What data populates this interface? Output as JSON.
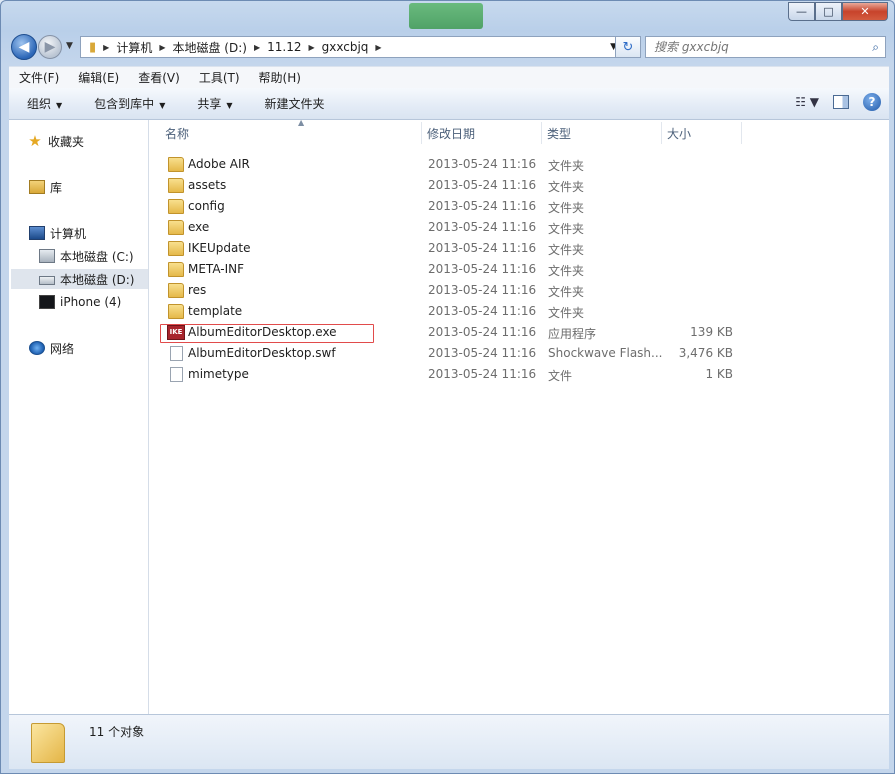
{
  "window": {
    "caption": {
      "minimize": "—",
      "maximize": "□",
      "close": "✕"
    }
  },
  "nav": {
    "back_icon": "back-arrow-icon",
    "forward_icon": "forward-arrow-icon",
    "breadcrumb": [
      "计算机",
      "本地磁盘 (D:)",
      "11.12",
      "gxxcbjq"
    ],
    "search_placeholder": "搜索 gxxcbjq"
  },
  "menubar": [
    "文件(F)",
    "编辑(E)",
    "查看(V)",
    "工具(T)",
    "帮助(H)"
  ],
  "toolbar": {
    "organize": "组织",
    "include_in_library": "包含到库中",
    "share": "共享",
    "new_folder": "新建文件夹"
  },
  "sidebar": {
    "favorites": "收藏夹",
    "libraries": "库",
    "computer": "计算机",
    "drive_c": "本地磁盘 (C:)",
    "drive_d": "本地磁盘 (D:)",
    "iphone": "iPhone (4)",
    "network": "网络"
  },
  "columns": {
    "name": "名称",
    "date": "修改日期",
    "type": "类型",
    "size": "大小"
  },
  "files": [
    {
      "name": "Adobe AIR",
      "date": "2013-05-24 11:16",
      "type": "文件夹",
      "size": "",
      "icon": "folder"
    },
    {
      "name": "assets",
      "date": "2013-05-24 11:16",
      "type": "文件夹",
      "size": "",
      "icon": "folder"
    },
    {
      "name": "config",
      "date": "2013-05-24 11:16",
      "type": "文件夹",
      "size": "",
      "icon": "folder"
    },
    {
      "name": "exe",
      "date": "2013-05-24 11:16",
      "type": "文件夹",
      "size": "",
      "icon": "folder"
    },
    {
      "name": "IKEUpdate",
      "date": "2013-05-24 11:16",
      "type": "文件夹",
      "size": "",
      "icon": "folder"
    },
    {
      "name": "META-INF",
      "date": "2013-05-24 11:16",
      "type": "文件夹",
      "size": "",
      "icon": "folder"
    },
    {
      "name": "res",
      "date": "2013-05-24 11:16",
      "type": "文件夹",
      "size": "",
      "icon": "folder"
    },
    {
      "name": "template",
      "date": "2013-05-24 11:16",
      "type": "文件夹",
      "size": "",
      "icon": "folder"
    },
    {
      "name": "AlbumEditorDesktop.exe",
      "date": "2013-05-24 11:16",
      "type": "应用程序",
      "size": "139 KB",
      "icon": "exe"
    },
    {
      "name": "AlbumEditorDesktop.swf",
      "date": "2013-05-24 11:16",
      "type": "Shockwave Flash...",
      "size": "3,476 KB",
      "icon": "doc"
    },
    {
      "name": "mimetype",
      "date": "2013-05-24 11:16",
      "type": "文件",
      "size": "1 KB",
      "icon": "doc"
    }
  ],
  "exe_icon_text": "IKE",
  "status": {
    "count": "11 个对象"
  },
  "colors": {
    "highlight": "#e14b4b",
    "accent": "#2b66b7"
  }
}
